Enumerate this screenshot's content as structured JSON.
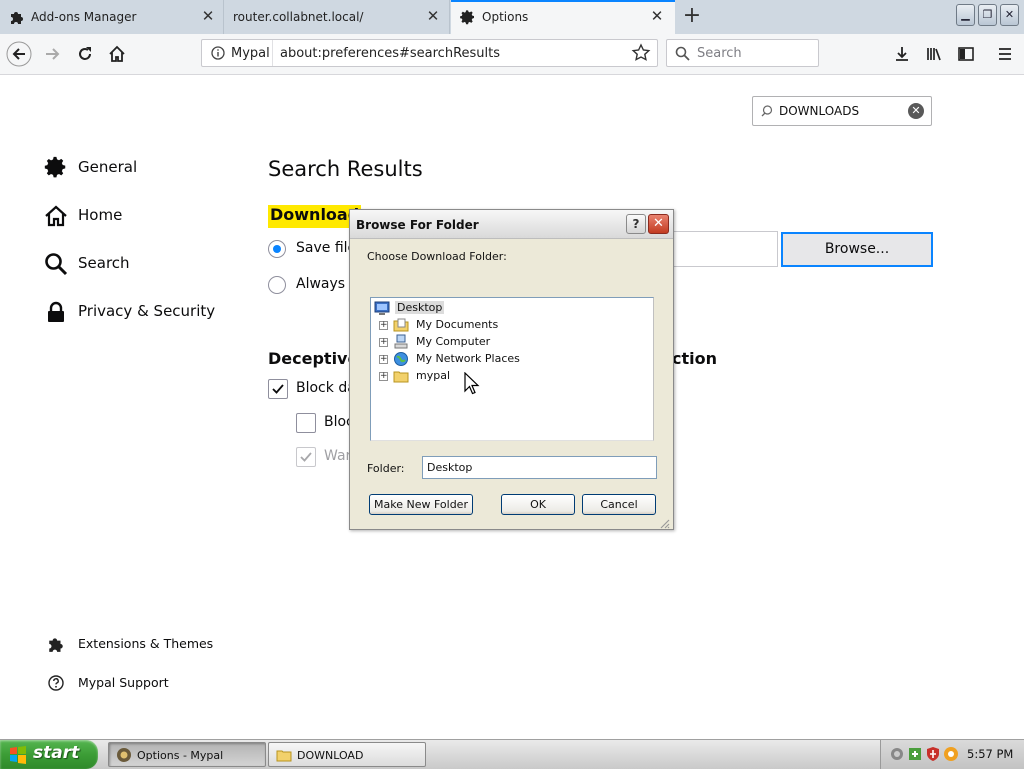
{
  "browser": {
    "tabs": [
      {
        "title": "Add-ons Manager",
        "icon": "puzzle-icon",
        "active": false
      },
      {
        "title": "router.collabnet.local/",
        "icon": "",
        "active": false
      },
      {
        "title": "Options",
        "icon": "gear-icon",
        "active": true
      }
    ],
    "identity_label": "Mypal",
    "url": "about:preferences#searchResults",
    "search_placeholder": "Search"
  },
  "preferences": {
    "find_value": "DOWNLOADS",
    "categories": [
      {
        "label": "General",
        "icon": "gear-icon"
      },
      {
        "label": "Home",
        "icon": "home-icon"
      },
      {
        "label": "Search",
        "icon": "search-icon"
      },
      {
        "label": "Privacy & Security",
        "icon": "lock-icon"
      }
    ],
    "footer_links": [
      {
        "label": "Extensions & Themes",
        "icon": "puzzle-icon"
      },
      {
        "label": "Mypal Support",
        "icon": "help-icon"
      }
    ],
    "heading": "Search Results",
    "downloads_label": "Download",
    "save_files_label": "Save files",
    "always_ask_label": "Always a",
    "deceptive_heading": "Deceptive",
    "deceptive_heading_tail": "ction",
    "block_dangerous_label": "Block da",
    "block_label": "Bloc",
    "warn_label": "War",
    "browse_button": "Browse..."
  },
  "dialog": {
    "title": "Browse For Folder",
    "help_label": "?",
    "prompt": "Choose Download Folder:",
    "tree": [
      {
        "label": "Desktop",
        "icon": "desktop-icon",
        "selected": true
      },
      {
        "label": "My Documents",
        "icon": "documents-folder-icon"
      },
      {
        "label": "My Computer",
        "icon": "computer-icon"
      },
      {
        "label": "My Network Places",
        "icon": "network-icon"
      },
      {
        "label": "mypal",
        "icon": "folder-icon"
      }
    ],
    "folder_label": "Folder:",
    "folder_value": "Desktop",
    "make_new_folder": "Make New Folder",
    "ok": "OK",
    "cancel": "Cancel"
  },
  "taskbar": {
    "start_label": "start",
    "tasks": [
      {
        "label": "Options - Mypal",
        "icon": "mypal-icon",
        "active": true
      },
      {
        "label": "DOWNLOAD",
        "icon": "folder-icon",
        "active": false
      }
    ],
    "clock": "5:57 PM"
  },
  "colors": {
    "accent": "#0a84ff",
    "highlight": "#ffe900",
    "tabstrip": "#cfd8e1",
    "xp_start_green": "#3c9d36"
  }
}
